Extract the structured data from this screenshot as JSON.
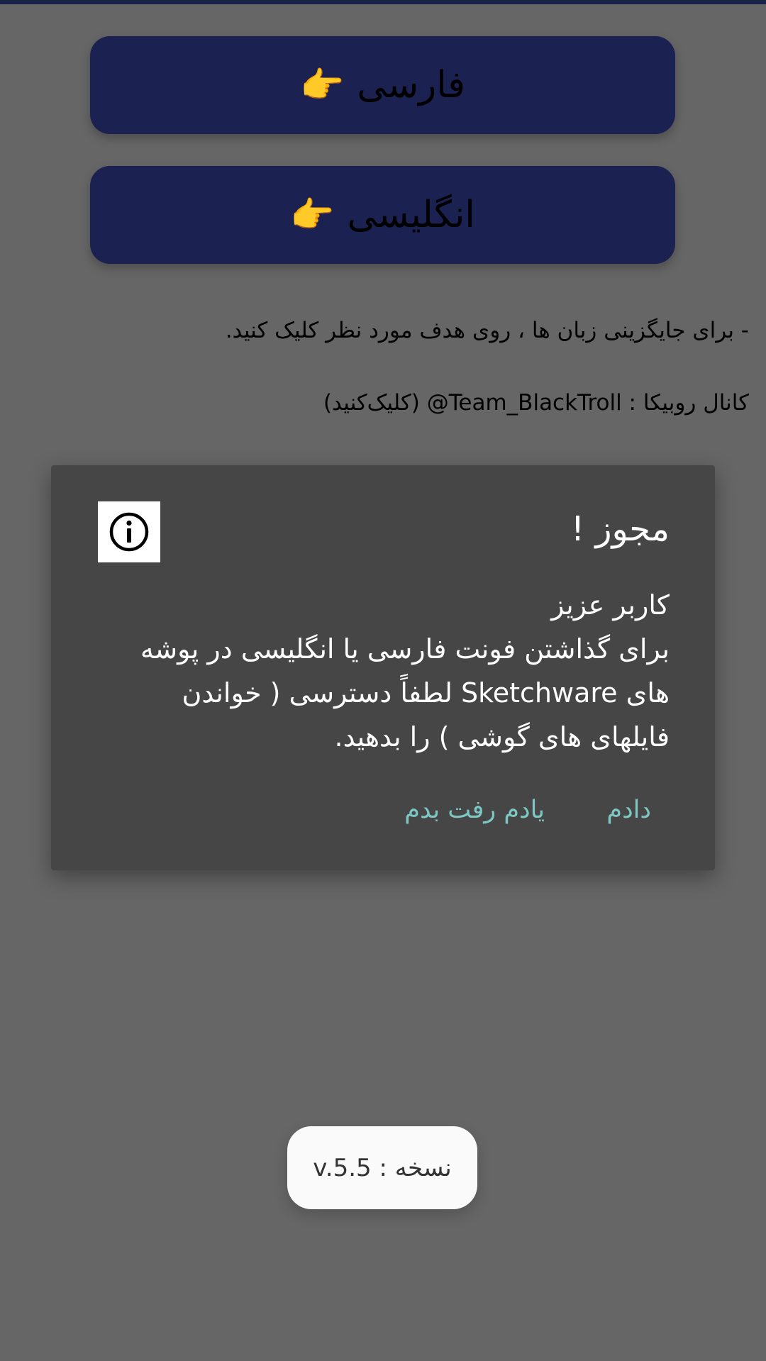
{
  "buttons": {
    "farsi_label": "فارسی",
    "english_label": "انگلیسی",
    "hand_icon": "👉"
  },
  "hint": {
    "text": "- برای جایگزینی زبان ها ، روی هدف مورد نظر کلیک کنید."
  },
  "channel": {
    "prefix": "کانال روبیکا : ",
    "handle": "@Team_BlackTroll",
    "suffix": " (کلیک‌کنید)"
  },
  "dialog": {
    "title": "مجوز !",
    "body_line1": "کاربر عزیز",
    "body_line2": "برای گذاشتن فونت فارسی یا انگلیسی در پوشه های Sketchware لطفاً دسترسی ( خواندن فایلهای های گوشی ) را بدهید.",
    "action_grant": "دادم",
    "action_later": "یادم رفت بدم"
  },
  "version": {
    "label": "نسخه : v.5.5"
  },
  "colors": {
    "background": "#666666",
    "button_bg": "#1b2150",
    "dialog_bg": "#464646",
    "dialog_action": "#7ec8c4",
    "toast_bg": "#fafafa"
  }
}
